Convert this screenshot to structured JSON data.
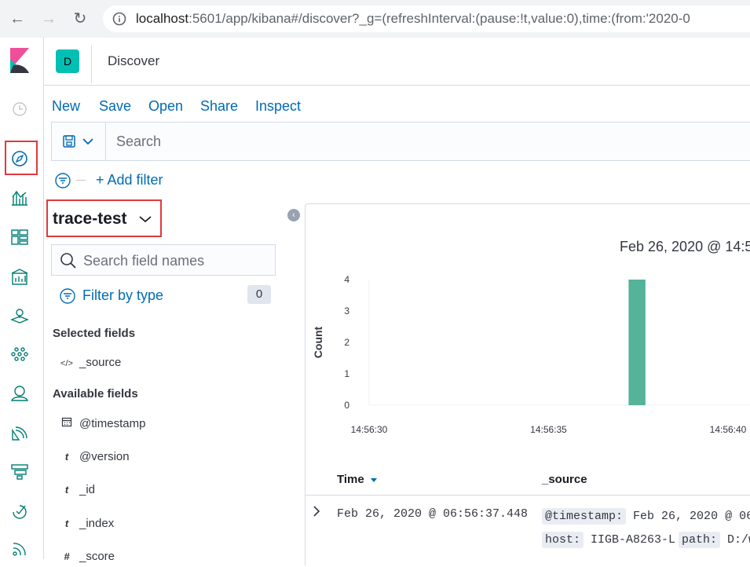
{
  "browser": {
    "url_host": "localhost",
    "url_rest": ":5601/app/kibana#/discover?_g=(refreshInterval:(pause:!t,value:0),time:(from:'2020-0"
  },
  "header": {
    "space_initial": "D",
    "page_title": "Discover"
  },
  "top_menu": {
    "new": "New",
    "save": "Save",
    "open": "Open",
    "share": "Share",
    "inspect": "Inspect"
  },
  "search": {
    "placeholder": "Search"
  },
  "filters": {
    "add_filter": "+ Add filter"
  },
  "sidebar": {
    "index_pattern": "trace-test",
    "field_search_placeholder": "Search field names",
    "filter_by_type": "Filter by type",
    "filter_count": "0",
    "selected_label": "Selected fields",
    "selected_fields": [
      {
        "type": "</>",
        "name": "_source"
      }
    ],
    "available_label": "Available fields",
    "available_fields": [
      {
        "type": "cal",
        "name": "@timestamp"
      },
      {
        "type": "t",
        "name": "@version"
      },
      {
        "type": "t",
        "name": "_id"
      },
      {
        "type": "t",
        "name": "_index"
      },
      {
        "type": "#",
        "name": "_score"
      }
    ]
  },
  "chart_data": {
    "type": "bar",
    "title": "Feb 26, 2020 @ 14:5",
    "ylabel": "Count",
    "xlabel": "",
    "y_ticks": [
      0,
      1,
      2,
      3,
      4
    ],
    "ylim": [
      0,
      4
    ],
    "x_ticks": [
      "14:56:30",
      "14:56:35",
      "14:56:40"
    ],
    "bars": [
      {
        "x": "14:56:37",
        "value": 4
      }
    ],
    "color": "#54b399"
  },
  "table": {
    "col_time": "Time",
    "col_source": "_source",
    "rows": [
      {
        "time": "Feb 26, 2020 @ 06:56:37.448",
        "ts_key": "@timestamp:",
        "ts_val": "Feb 26, 2020 @ 06",
        "host_key": "host:",
        "host_val": "IIGB-A8263-L",
        "path_key": "path:",
        "path_val": "D:/w"
      }
    ]
  },
  "colors": {
    "link": "#006bb4",
    "highlight": "#e0393e",
    "bar": "#54b399",
    "space_badge": "#00bfb3"
  }
}
